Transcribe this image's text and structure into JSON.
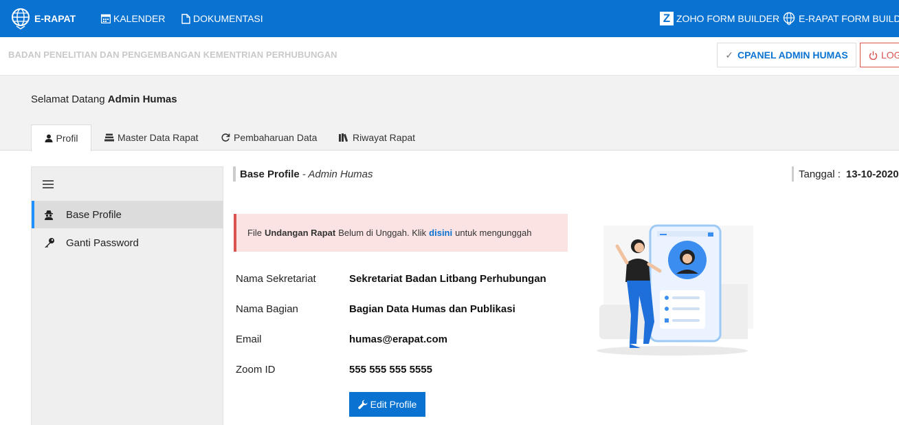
{
  "navbar": {
    "brand": "E-RAPAT",
    "kalender": "KALENDER",
    "dokumentasi": "DOKUMENTASI",
    "zoho": "ZOHO FORM BUILDER",
    "erapat_form": "E-RAPAT FORM BUILDER",
    "zoho_letter": "Z"
  },
  "subbar": {
    "org": "BADAN PENELITIAN DAN PENGEMBANGAN KEMENTRIAN PERHUBUNGAN",
    "cpanel": "CPANEL ADMIN HUMAS",
    "logout": "LOGOUT"
  },
  "welcome": {
    "prefix": "Selamat Datang",
    "name": "Admin Humas"
  },
  "tabs": [
    "Profil",
    "Master Data Rapat",
    "Pembaharuan Data",
    "Riwayat Rapat"
  ],
  "sidebar": {
    "items": [
      "Base Profile",
      "Ganti Password"
    ]
  },
  "page": {
    "title": "Base Profile",
    "subtitle": "- Admin Humas",
    "tanggal_label": "Tanggal :",
    "tanggal_value": "13-10-2020"
  },
  "alert": {
    "part1": "File",
    "bold": "Undangan Rapat",
    "part2": "Belum di Unggah. Klik",
    "link": "disini",
    "part3": "untuk mengunggah"
  },
  "profile": {
    "rows": [
      {
        "label": "Nama Sekretariat",
        "value": "Sekretariat Badan Litbang Perhubungan"
      },
      {
        "label": "Nama Bagian",
        "value": "Bagian Data Humas dan Publikasi"
      },
      {
        "label": "Email",
        "value": "humas@erapat.com"
      },
      {
        "label": "Zoom ID",
        "value": "555 555 555 5555"
      }
    ],
    "edit_button": "Edit Profile"
  },
  "colors": {
    "primary": "#0a73d1",
    "danger": "#d9534f",
    "alert_bg": "#fbe3e3"
  },
  "icons": [
    "globe-icon",
    "calendar-icon",
    "file-icon",
    "zoho-icon",
    "user-icon",
    "stack-icon",
    "refresh-icon",
    "books-icon",
    "menu-icon",
    "spy-icon",
    "key-icon",
    "wrench-icon",
    "check-icon",
    "power-icon"
  ]
}
